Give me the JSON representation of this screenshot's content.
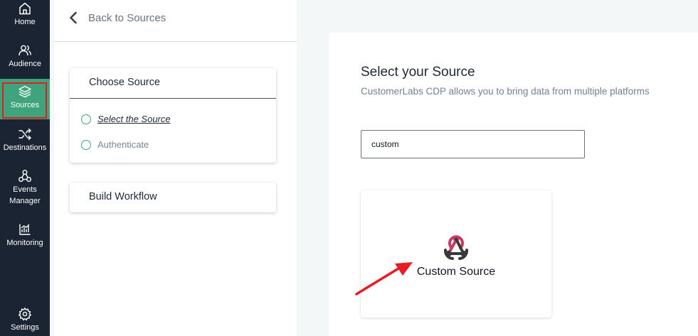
{
  "sidebar": {
    "items": [
      {
        "label": "Home",
        "icon": "home-icon"
      },
      {
        "label": "Audience",
        "icon": "users-icon"
      },
      {
        "label": "Sources",
        "icon": "layers-icon",
        "active": true
      },
      {
        "label": "Destinations",
        "icon": "shuffle-icon"
      },
      {
        "label": "Events\nManager",
        "icon": "events-network-icon"
      },
      {
        "label": "Monitoring",
        "icon": "chart-icon"
      },
      {
        "label": "Settings",
        "icon": "gear-icon"
      }
    ]
  },
  "left_panel": {
    "back_label": "Back to Sources",
    "steps": {
      "choose_title": "Choose Source",
      "substeps": [
        "Select the Source",
        "Authenticate"
      ],
      "build_title": "Build Workflow"
    }
  },
  "main": {
    "title": "Select your Source",
    "subtitle": "CustomerLabs CDP allows you to bring data from multiple platforms",
    "search_value": "custom",
    "result_label": "Custom Source"
  },
  "colors": {
    "sidebar_bg": "#1a2433",
    "accent": "#3fa37c",
    "highlight": "#e81b23",
    "webhook_pink": "#c73a63",
    "webhook_dark": "#3a3a3a"
  }
}
